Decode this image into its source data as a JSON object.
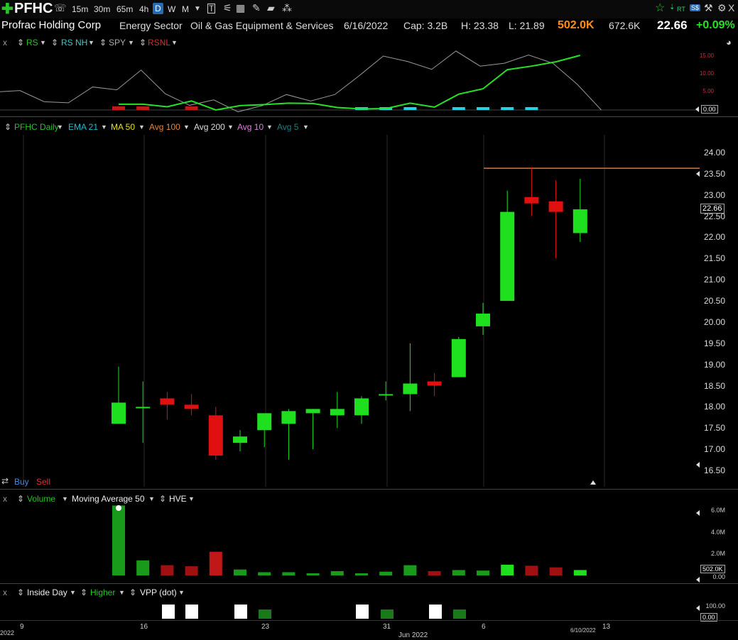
{
  "header": {
    "symbol": "PFHC",
    "timeframes": [
      "15m",
      "30m",
      "65m",
      "4h",
      "D",
      "W",
      "M"
    ],
    "active_timeframe": "D",
    "icons": [
      "add-icon",
      "phone-icon",
      "table-icon",
      "calendar-icon",
      "pencil-icon",
      "note-icon",
      "share-icon"
    ],
    "right_icons": {
      "star": "☆",
      "rt": "RT",
      "sp": "S$",
      "tool": "⚒",
      "close": "X"
    }
  },
  "info": {
    "name": "Profrac Holding Corp",
    "sector": "Energy Sector",
    "industry": "Oil & Gas Equipment & Services",
    "date": "6/16/2022",
    "cap": "Cap: 3.2B",
    "high": "H: 23.38",
    "low": "L: 21.89",
    "volume": "502.0K",
    "avg_volume": "672.6K",
    "last": "22.66",
    "change": "+0.09%"
  },
  "rs_panel": {
    "close": "x",
    "items": [
      "RS",
      "RS NH",
      "SPY",
      "RSNL"
    ],
    "ylabels": [
      "15.00",
      "10.00",
      "5.00",
      "0.00"
    ],
    "value_tag": "0.00"
  },
  "price_panel": {
    "items": [
      "PFHC Daily",
      "EMA 21",
      "MA 50",
      "Avg 100",
      "Avg 200",
      "Avg 10",
      "Avg 5"
    ],
    "ylabels": [
      "24.00",
      "23.50",
      "23.00",
      "22.50",
      "22.00",
      "21.50",
      "21.00",
      "20.50",
      "20.00",
      "19.50",
      "19.00",
      "18.50",
      "18.00",
      "17.50",
      "17.00",
      "16.50"
    ],
    "price_tag": "22.66",
    "buy": "Buy",
    "sell": "Sell"
  },
  "volume_panel": {
    "close": "x",
    "items": [
      "Volume",
      "Moving Average 50",
      "HVE"
    ],
    "ylabels": [
      "6.0M",
      "4.0M",
      "2.0M",
      "0.00"
    ],
    "value_tag": "502.0K"
  },
  "bottom_panel": {
    "close": "x",
    "items": [
      "Inside Day",
      "Higher",
      "VPP (dot)"
    ],
    "ylabels": [
      "100.00",
      "0.00"
    ]
  },
  "xaxis": {
    "labels": [
      "9",
      "16",
      "23",
      "31",
      "6",
      "13"
    ],
    "month_label": "Jun 2022",
    "date_tag": "6/10/2022",
    "left_label": "2022"
  },
  "chart_data": {
    "type": "candlestick",
    "y_range": [
      16.3,
      24.3
    ],
    "candles": [
      {
        "o": 17.6,
        "h": 18.95,
        "l": 17.6,
        "c": 18.1
      },
      {
        "o": 18.0,
        "h": 18.6,
        "l": 17.15,
        "c": 18.0
      },
      {
        "o": 18.2,
        "h": 18.35,
        "l": 17.7,
        "c": 18.05
      },
      {
        "o": 18.05,
        "h": 18.3,
        "l": 17.8,
        "c": 17.95
      },
      {
        "o": 17.8,
        "h": 18.0,
        "l": 16.75,
        "c": 16.85
      },
      {
        "o": 17.15,
        "h": 17.45,
        "l": 16.95,
        "c": 17.3
      },
      {
        "o": 17.45,
        "h": 17.85,
        "l": 17.05,
        "c": 17.85
      },
      {
        "o": 17.6,
        "h": 17.95,
        "l": 16.75,
        "c": 17.9
      },
      {
        "o": 17.85,
        "h": 17.95,
        "l": 17.0,
        "c": 17.95
      },
      {
        "o": 17.8,
        "h": 18.35,
        "l": 17.5,
        "c": 17.95
      },
      {
        "o": 17.8,
        "h": 18.25,
        "l": 17.6,
        "c": 18.2
      },
      {
        "o": 18.3,
        "h": 18.6,
        "l": 18.15,
        "c": 18.3
      },
      {
        "o": 18.3,
        "h": 19.5,
        "l": 17.9,
        "c": 18.55
      },
      {
        "o": 18.6,
        "h": 18.8,
        "l": 18.25,
        "c": 18.5
      },
      {
        "o": 18.7,
        "h": 19.65,
        "l": 18.7,
        "c": 19.6
      },
      {
        "o": 19.9,
        "h": 20.45,
        "l": 19.7,
        "c": 20.2
      },
      {
        "o": 20.5,
        "h": 23.1,
        "l": 20.5,
        "c": 22.6
      },
      {
        "o": 22.95,
        "h": 23.65,
        "l": 22.5,
        "c": 22.8
      },
      {
        "o": 22.85,
        "h": 23.35,
        "l": 21.5,
        "c": 22.6
      },
      {
        "o": 22.1,
        "h": 23.38,
        "l": 21.89,
        "c": 22.66
      }
    ],
    "resistance_line": 23.63,
    "volume": [
      6.5,
      1.4,
      0.95,
      0.85,
      2.2,
      0.55,
      0.3,
      0.3,
      0.2,
      0.4,
      0.2,
      0.35,
      0.95,
      0.4,
      0.5,
      0.45,
      1.0,
      0.9,
      0.75,
      0.502
    ],
    "volume_ylim": [
      0,
      6.5
    ],
    "rs_line": [
      1.6,
      1.6,
      0.9,
      2.5,
      0,
      1.2,
      1.5,
      1.9,
      1.8,
      0.7,
      0.3,
      0.4,
      1.9,
      0.8,
      4.4,
      5.9,
      11.2,
      12.2,
      13.4,
      15.2
    ],
    "spy_line": [
      5,
      5.4,
      2.3,
      2.0,
      6.4,
      5.6,
      11.1,
      4.5,
      1.3,
      2.8,
      -0.5,
      1.2,
      4.3,
      2.5,
      4.3,
      9.5,
      15,
      13.5,
      11.3,
      16.4,
      12.2,
      13,
      15.3,
      13,
      7.2,
      0
    ],
    "rs_ylim": [
      0,
      16.5
    ],
    "rsnl_red": [
      0,
      1,
      3
    ],
    "rsnl_cyan": [
      10,
      11,
      12,
      14,
      15,
      16,
      17
    ],
    "inside_day": [
      2,
      3,
      5,
      10,
      13
    ],
    "higher": [
      6,
      11,
      14
    ]
  }
}
